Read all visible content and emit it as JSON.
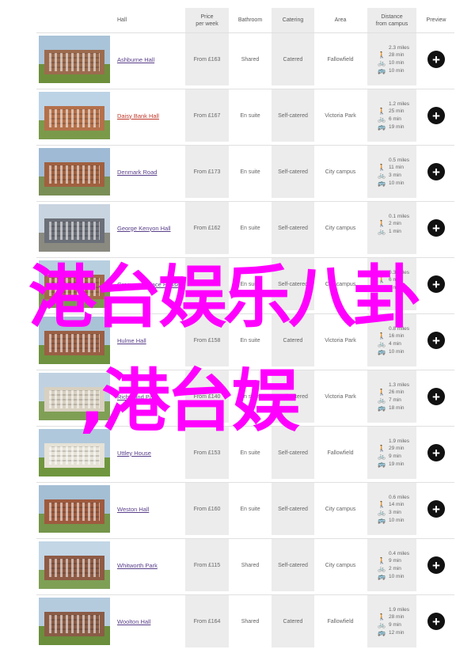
{
  "headers": {
    "hall": "Hall",
    "price": "Price\nper week",
    "bathroom": "Bathroom",
    "catering": "Catering",
    "area": "Area",
    "distance": "Distance\nfrom campus",
    "preview": "Preview"
  },
  "halls": [
    {
      "name": "Ashburne Hall",
      "price": "From £163",
      "bathroom": "Shared",
      "catering": "Catered",
      "area": "Fallowfield",
      "walk": "2.3 miles",
      "bike": "28 min",
      "cycle": "10 min",
      "bus": "10 min",
      "sky": "#a9c3d8",
      "building": "#9c6b4e",
      "ground": "#6d8f3c",
      "link_color": "#5a3f8a"
    },
    {
      "name": "Daisy Bank Hall",
      "price": "From £167",
      "bathroom": "En suite",
      "catering": "Self-catered",
      "area": "Victoria Park",
      "walk": "1.2 miles",
      "bike": "25 min",
      "cycle": "6 min",
      "bus": "19 min",
      "sky": "#bcd3e6",
      "building": "#b4704a",
      "ground": "#7a9a4a",
      "link_color": "#c0392b"
    },
    {
      "name": "Denmark Road",
      "price": "From £173",
      "bathroom": "En suite",
      "catering": "Self-catered",
      "area": "City campus",
      "walk": "0.5 miles",
      "bike": "11 min",
      "cycle": "3 min",
      "bus": "10 min",
      "sky": "#9fbad4",
      "building": "#a0603f",
      "ground": "#7a8f55",
      "link_color": "#5a3f8a"
    },
    {
      "name": "George Kenyon Hall",
      "price": "From £162",
      "bathroom": "En suite",
      "catering": "Self-catered",
      "area": "City campus",
      "walk": "0.1 miles",
      "bike": "2 min",
      "cycle": "1 min",
      "bus": "",
      "sky": "#c8d4e0",
      "building": "#6b6f78",
      "ground": "#8a8a80",
      "link_color": "#5a3f8a"
    },
    {
      "name": "Grosvenor Place House",
      "price": "From £171",
      "bathroom": "En suite",
      "catering": "Self-catered",
      "area": "City campus",
      "walk": "0.3 miles",
      "bike": "6 min",
      "cycle": "2 min",
      "bus": "",
      "sky": "#b8cfe0",
      "building": "#a36a4a",
      "ground": "#7d9a52",
      "link_color": "#5a3f8a"
    },
    {
      "name": "Hulme Hall",
      "price": "From £158",
      "bathroom": "En suite",
      "catering": "Catered",
      "area": "Victoria Park",
      "walk": "0.8 miles",
      "bike": "16 min",
      "cycle": "4 min",
      "bus": "10 min",
      "sky": "#a8c2d6",
      "building": "#9a5f45",
      "ground": "#6e9240",
      "link_color": "#5a3f8a"
    },
    {
      "name": "Richmond Park",
      "price": "From £140",
      "bathroom": "En suite",
      "catering": "Self-catered",
      "area": "Victoria Park",
      "walk": "1.3 miles",
      "bike": "26 min",
      "cycle": "7 min",
      "bus": "18 min",
      "sky": "#c0d2e2",
      "building": "#d8d0c0",
      "ground": "#7f9f55",
      "link_color": "#5a3f8a"
    },
    {
      "name": "Uttley House",
      "price": "From £153",
      "bathroom": "En suite",
      "catering": "Self-catered",
      "area": "Fallowfield",
      "walk": "1.9 miles",
      "bike": "29 min",
      "cycle": "9 min",
      "bus": "19 min",
      "sky": "#b0c8dc",
      "building": "#e6e2d6",
      "ground": "#6f963e",
      "link_color": "#5a3f8a"
    },
    {
      "name": "Weston Hall",
      "price": "From £160",
      "bathroom": "En suite",
      "catering": "Self-catered",
      "area": "City campus",
      "walk": "0.6 miles",
      "bike": "14 min",
      "cycle": "3 min",
      "bus": "10 min",
      "sky": "#a4bed4",
      "building": "#9e5a3e",
      "ground": "#74954a",
      "link_color": "#5a3f8a"
    },
    {
      "name": "Whitworth Park",
      "price": "From £115",
      "bathroom": "Shared",
      "catering": "Self-catered",
      "area": "City campus",
      "walk": "0.4 miles",
      "bike": "9 min",
      "cycle": "2 min",
      "bus": "10 min",
      "sky": "#c2d6e6",
      "building": "#8e5a44",
      "ground": "#7ea055",
      "link_color": "#5a3f8a"
    },
    {
      "name": "Woolton Hall",
      "price": "From £164",
      "bathroom": "Shared",
      "catering": "Catered",
      "area": "Fallowfield",
      "walk": "1.9 miles",
      "bike": "28 min",
      "cycle": "9 min",
      "bus": "12 min",
      "sky": "#b4cbde",
      "building": "#8a5c46",
      "ground": "#6a8e3c",
      "link_color": "#5a3f8a"
    }
  ],
  "preview_button_symbol": "+",
  "icons": {
    "walk": "walking-person-icon",
    "bike": "bicycle-icon",
    "cycle": "cycle-icon",
    "bus": "bus-icon"
  },
  "overlay": {
    "line1": "港台娱乐八卦",
    "line2": ",港台娱",
    "color": "#ff00ff"
  }
}
